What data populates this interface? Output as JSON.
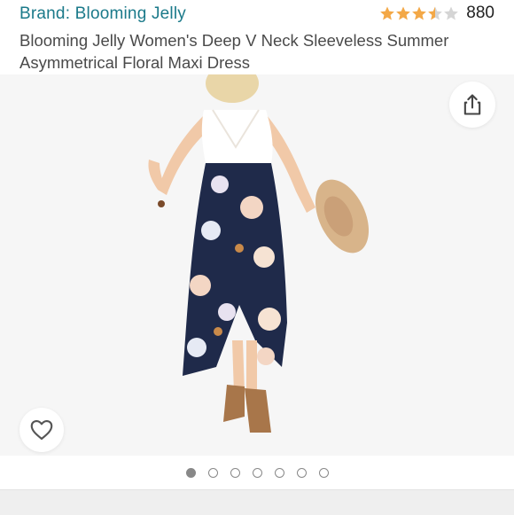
{
  "header": {
    "brand_label": "Brand: Blooming Jelly",
    "rating_count": "880",
    "rating_value": 3.5,
    "rating_max": 5,
    "title_line1": "Blooming Jelly Women's Deep V Neck Sleeveless Summer",
    "title_line2": "Asymmetrical Floral Maxi Dress"
  },
  "gallery": {
    "image_count": 7,
    "active_index": 0,
    "share_icon": "share-icon",
    "wishlist_icon": "heart-icon"
  },
  "colors": {
    "brand_link": "#1b7a8a",
    "star_filled": "#f3a847",
    "star_empty": "#d5d5d5",
    "skirt_navy": "#1f2a4a",
    "top_white": "#ffffff",
    "hat_tan": "#d8b48a",
    "boots_brown": "#a8764a"
  }
}
